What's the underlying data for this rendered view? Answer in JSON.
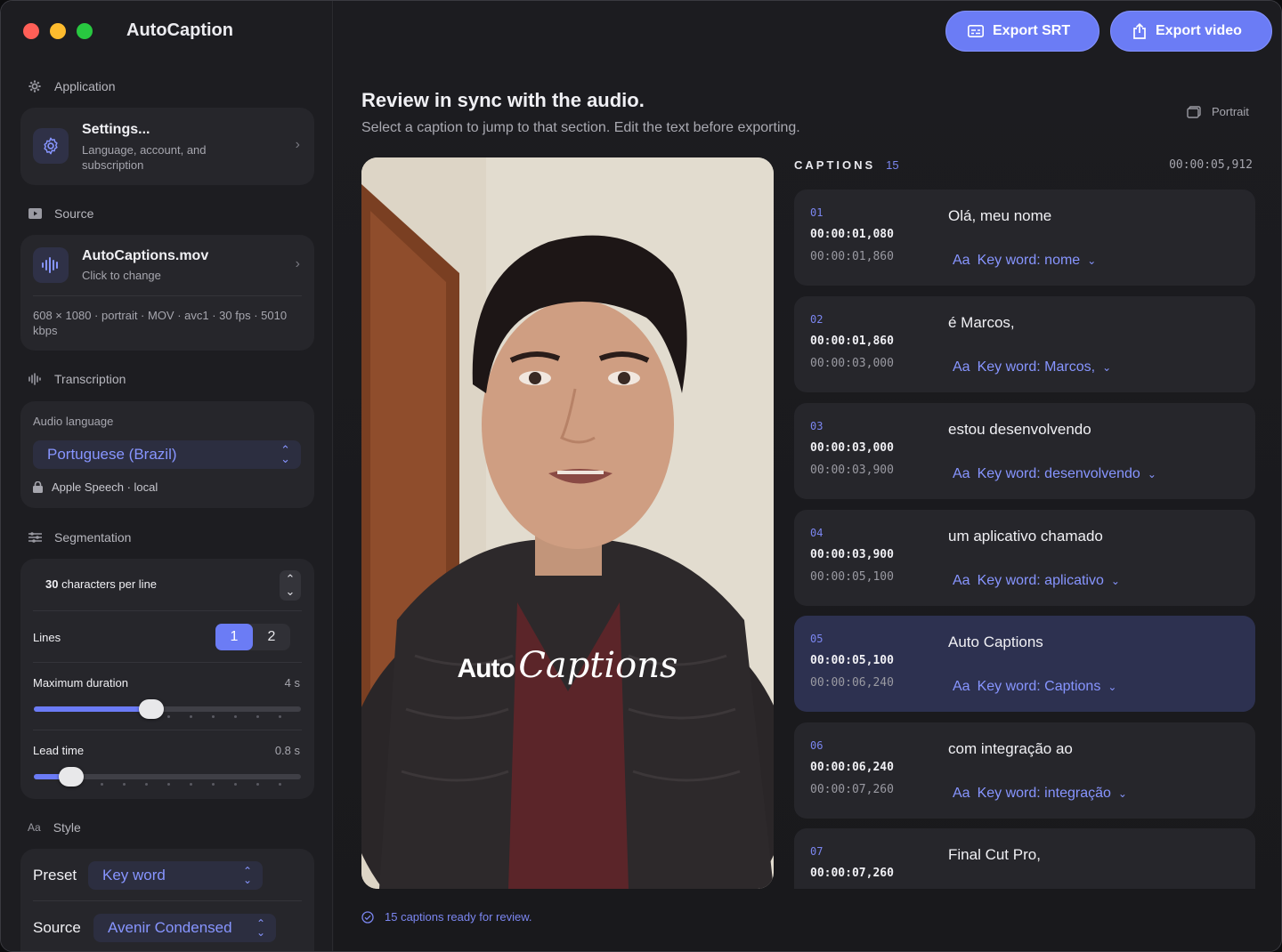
{
  "app": {
    "title": "AutoCaption"
  },
  "toolbar": {
    "export_srt": "Export SRT",
    "export_video": "Export video"
  },
  "sidebar": {
    "application": {
      "header": "Application",
      "settings_title": "Settings...",
      "settings_sub": "Language, account, and subscription"
    },
    "source": {
      "header": "Source",
      "file_name": "AutoCaptions.mov",
      "file_sub": "Click to change",
      "meta": "608 × 1080 · portrait · MOV · avc1 · 30 fps · 5010 kbps"
    },
    "transcription": {
      "header": "Transcription",
      "audio_language_label": "Audio language",
      "audio_language_value": "Portuguese (Brazil)",
      "engine": "Apple Speech · local"
    },
    "segmentation": {
      "header": "Segmentation",
      "chars_per_line": "30",
      "chars_label": "characters per line",
      "lines_label": "Lines",
      "lines_options": [
        "1",
        "2"
      ],
      "lines_selected": "1",
      "max_duration_label": "Maximum duration",
      "max_duration_value": "4 s",
      "max_duration_fraction": 0.44,
      "lead_time_label": "Lead time",
      "lead_time_value": "0.8 s",
      "lead_time_fraction": 0.14
    },
    "style": {
      "header_icon": "Aa",
      "header": "Style",
      "preset_label": "Preset",
      "preset_value": "Key word",
      "source_label": "Source",
      "source_value": "Avenir Condensed"
    }
  },
  "main": {
    "headline": "Review in sync with the audio.",
    "subline": "Select a caption to jump to that section. Edit the text before exporting.",
    "orientation": "Portrait",
    "captions_label": "CAPTIONS",
    "captions_count": "15",
    "current_time": "00:00:05,912",
    "overlay_word1": "Auto",
    "overlay_word2": "Captions",
    "status": "15 captions ready for review.",
    "captions": [
      {
        "idx": "01",
        "start": "00:00:01,080",
        "end": "00:00:01,860",
        "text": "Olá, meu nome",
        "kw_icon": "Aa",
        "kw": "Key word: nome"
      },
      {
        "idx": "02",
        "start": "00:00:01,860",
        "end": "00:00:03,000",
        "text": "é Marcos,",
        "kw_icon": "Aa",
        "kw": "Key word: Marcos,"
      },
      {
        "idx": "03",
        "start": "00:00:03,000",
        "end": "00:00:03,900",
        "text": "estou desenvolvendo",
        "kw_icon": "Aa",
        "kw": "Key word: desenvolvendo"
      },
      {
        "idx": "04",
        "start": "00:00:03,900",
        "end": "00:00:05,100",
        "text": "um aplicativo chamado",
        "kw_icon": "Aa",
        "kw": "Key word: aplicativo"
      },
      {
        "idx": "05",
        "start": "00:00:05,100",
        "end": "00:00:06,240",
        "text": "Auto Captions",
        "kw_icon": "Aa",
        "kw": "Key word: Captions"
      },
      {
        "idx": "06",
        "start": "00:00:06,240",
        "end": "00:00:07,260",
        "text": "com integração ao",
        "kw_icon": "Aa",
        "kw": "Key word: integração"
      },
      {
        "idx": "07",
        "start": "00:00:07,260",
        "end": "",
        "text": "Final Cut Pro,",
        "kw_icon": "",
        "kw": ""
      }
    ]
  },
  "colors": {
    "accent": "#6b7cf5",
    "active_row": "#2d3150",
    "close": "#ff5f57",
    "minimize": "#febc2e",
    "zoom": "#28c840"
  }
}
